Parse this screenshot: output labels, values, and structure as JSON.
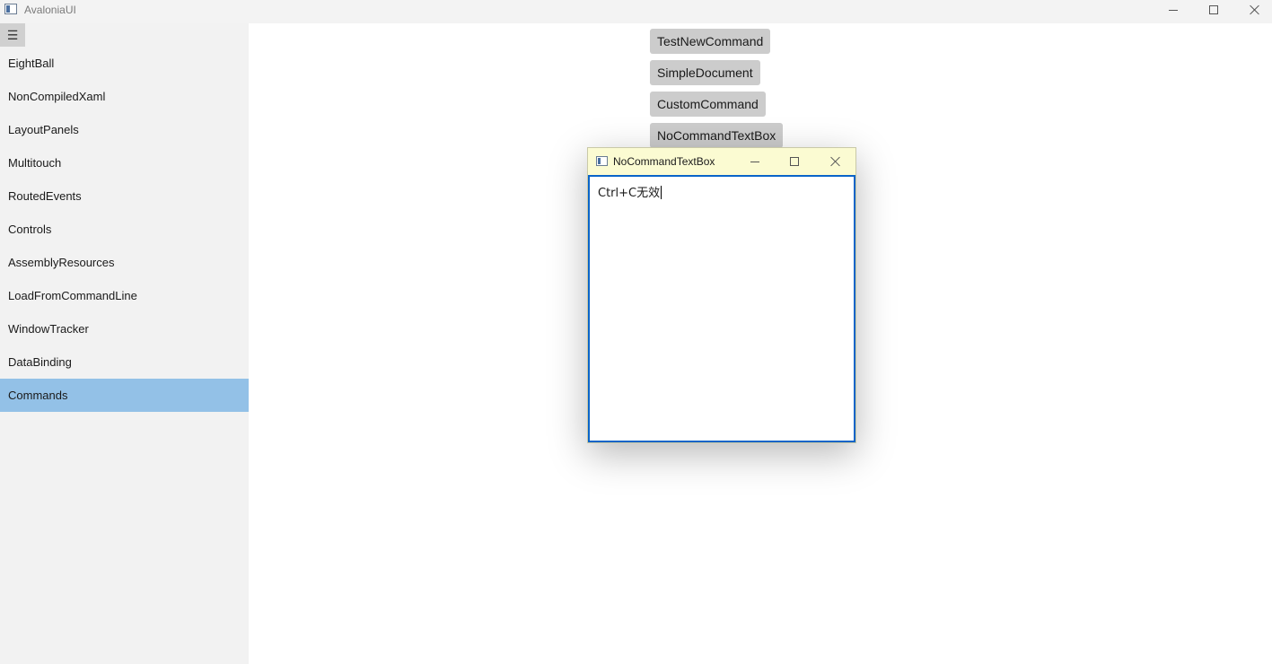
{
  "window": {
    "title": "AvaloniaUI"
  },
  "sidebar": {
    "toggle_icon": "hamburger-icon",
    "items": [
      {
        "label": "EightBall"
      },
      {
        "label": "NonCompiledXaml"
      },
      {
        "label": "LayoutPanels"
      },
      {
        "label": "Multitouch"
      },
      {
        "label": "RoutedEvents"
      },
      {
        "label": "Controls"
      },
      {
        "label": "AssemblyResources"
      },
      {
        "label": "LoadFromCommandLine"
      },
      {
        "label": "WindowTracker"
      },
      {
        "label": "DataBinding"
      },
      {
        "label": "Commands"
      }
    ],
    "selected": "Commands"
  },
  "main": {
    "buttons": [
      {
        "label": "TestNewCommand"
      },
      {
        "label": "SimpleDocument"
      },
      {
        "label": "CustomCommand"
      },
      {
        "label": "NoCommandTextBox"
      }
    ]
  },
  "dialog": {
    "title": "NoCommandTextBox",
    "text": "Ctrl+C无效"
  },
  "colors": {
    "selected_item": "#93c1e7",
    "dialog_titlebar": "#fbfbd2",
    "textbox_focus_border": "#0a64c8",
    "command_button": "#cccccc"
  }
}
